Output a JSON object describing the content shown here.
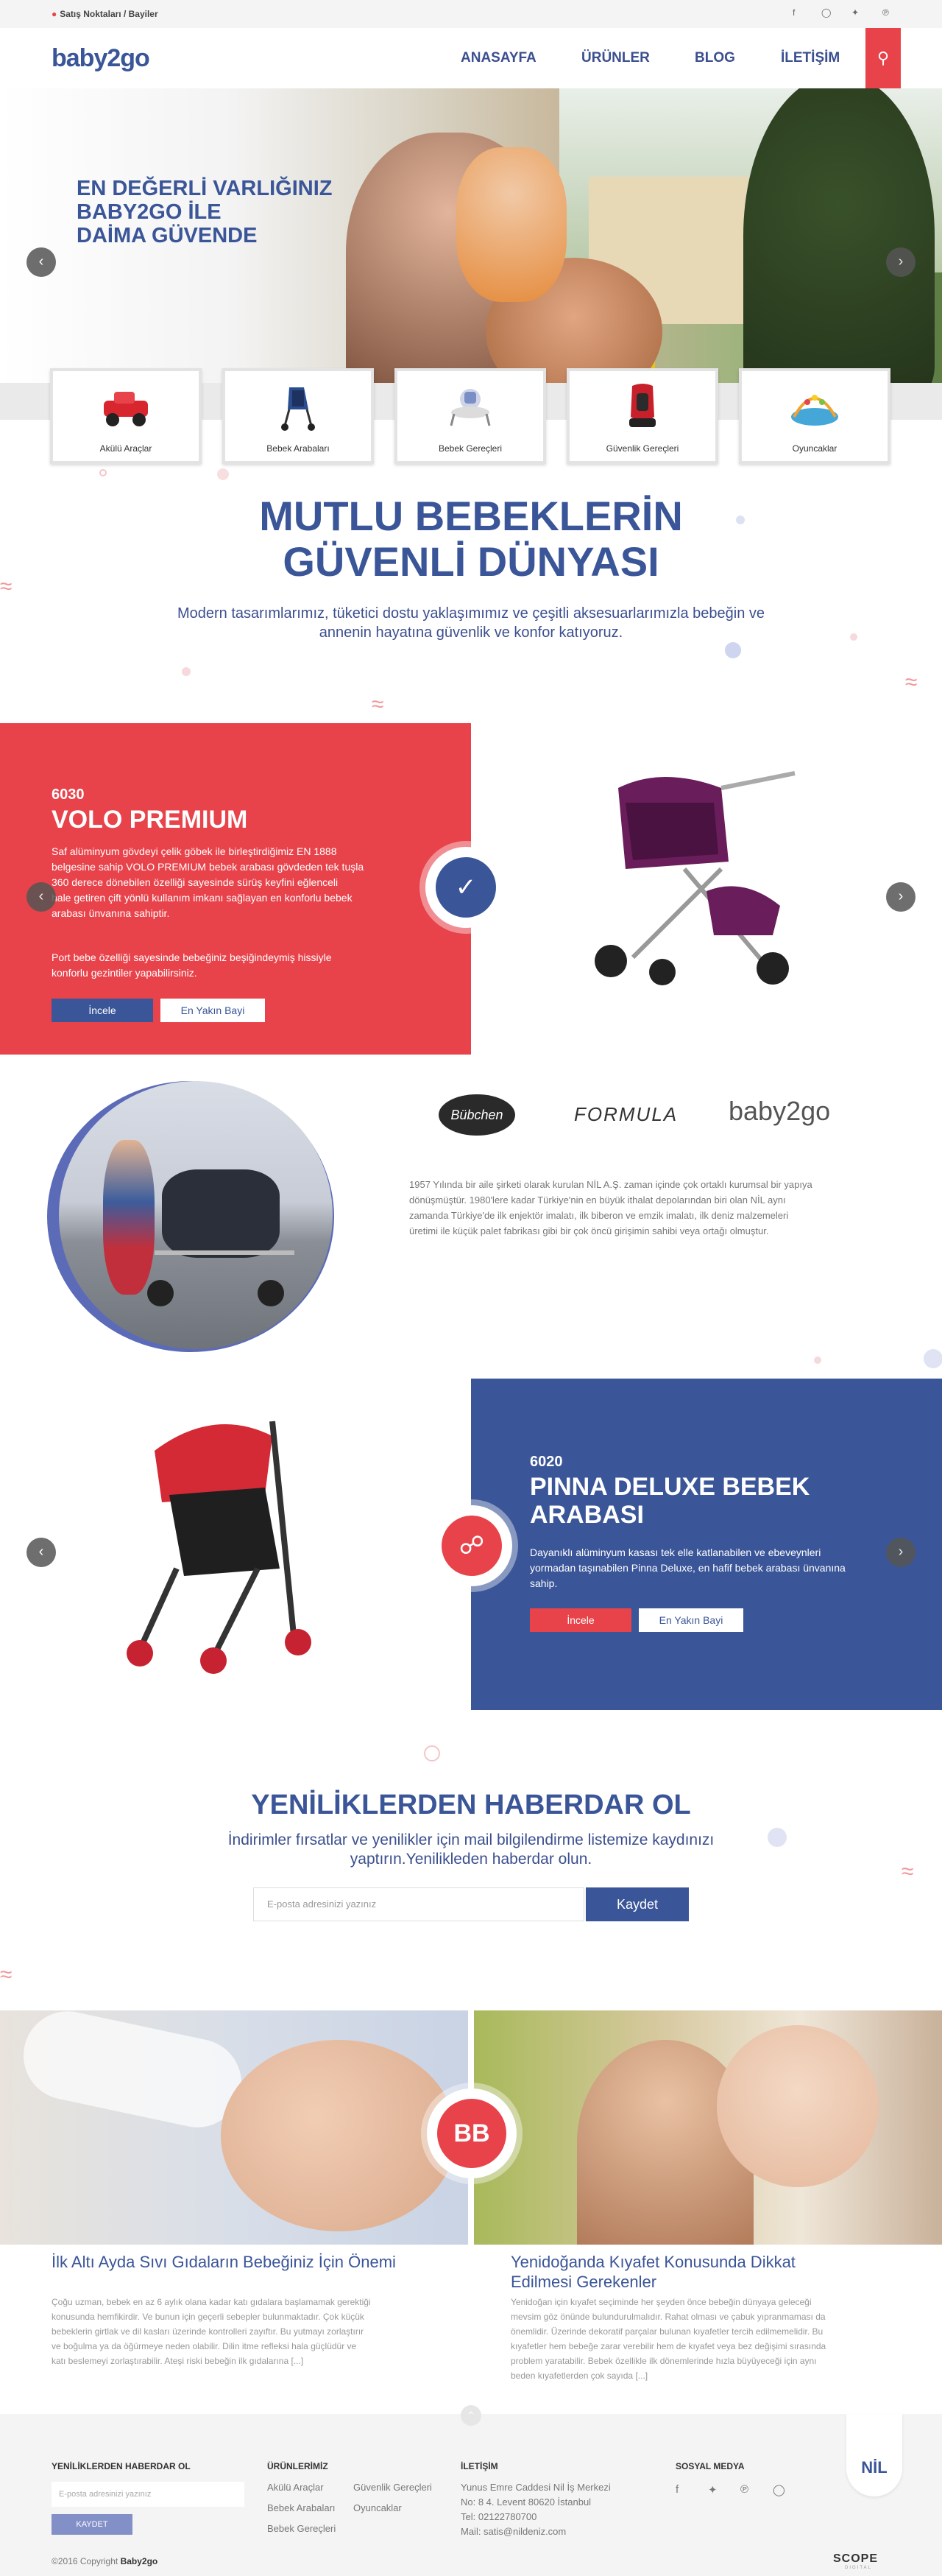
{
  "topbar": {
    "location_text": "Satış Noktaları / Bayiler",
    "social_icons": [
      "facebook-icon",
      "instagram-icon",
      "twitter-icon",
      "pinterest-icon"
    ]
  },
  "header": {
    "logo": "baby2go",
    "nav": [
      "ANASAYFA",
      "ÜRÜNLER",
      "BLOG",
      "İLETİŞİM"
    ]
  },
  "hero": {
    "headline_lines": [
      "EN DEĞERLİ VARLIĞINIZ",
      "BABY2GO İLE",
      "DAİMA GÜVENDE"
    ]
  },
  "categories": [
    {
      "label": "Akülü Araçlar",
      "icon": "ride-on-car-icon"
    },
    {
      "label": "Bebek Arabaları",
      "icon": "stroller-icon"
    },
    {
      "label": "Bebek Gereçleri",
      "icon": "walker-icon"
    },
    {
      "label": "Güvenlik Gereçleri",
      "icon": "car-seat-icon"
    },
    {
      "label": "Oyuncaklar",
      "icon": "play-gym-icon"
    }
  ],
  "intro": {
    "title_lines": [
      "MUTLU BEBEKLERİN",
      "GÜVENLİ DÜNYASI"
    ],
    "text_lines": [
      "Modern tasarımlarımız, tüketici dostu yaklaşımımız ve çeşitli aksesuarlarımızla bebeğin ve",
      "annenin hayatına güvenlik ve konfor katıyoruz."
    ]
  },
  "product1": {
    "code": "6030",
    "title": "VOLO PREMIUM",
    "desc_lines": [
      "Saf alüminyum gövdeyi çelik göbek ile birleştirdiğimiz EN 1888",
      "belgesine sahip VOLO PREMIUM bebek arabası gövdeden tek tuşla",
      "360 derece dönebilen özelliği sayesinde sürüş keyfini eğlenceli",
      "hale getiren çift yönlü kullanım imkanı sağlayan en konforlu bebek",
      "arabası ünvanına sahiptir."
    ],
    "desc2_lines": [
      "Port bebe özelliği sayesinde bebeğiniz beşiğindeymiş hissiyle",
      "konforlu gezintiler yapabilirsiniz."
    ],
    "btn_primary": "İncele",
    "btn_secondary": "En Yakın Bayi",
    "badge_icon": "shield-check-icon"
  },
  "brands": {
    "names": [
      "Bübchen",
      "FORMULA",
      "baby2go"
    ],
    "text_lines": [
      "1957 Yılında bir aile şirketi olarak kurulan NİL A.Ş. zaman içinde çok ortaklı kurumsal bir yapıya",
      "dönüşmüştür. 1980'lere kadar Türkiye'nin en büyük ithalat depolarından biri olan NİL aynı",
      "zamanda Türkiye'de ilk enjektör imalatı, ilk biberon ve emzik imalatı, ilk deniz malzemeleri",
      "üretimi ile küçük palet fabrikası gibi bir çok öncü girişimin sahibi veya ortağı olmuştur."
    ]
  },
  "product2": {
    "code": "6020",
    "title_lines": [
      "PINNA DELUXE BEBEK",
      "ARABASI"
    ],
    "desc_lines": [
      "Dayanıklı alüminyum kasası tek elle katlanabilen ve ebeveynleri",
      "yormadan taşınabilen Pinna Deluxe, en hafif bebek arabası ünvanına",
      "sahip."
    ],
    "btn_primary": "İncele",
    "btn_secondary": "En Yakın Bayi",
    "badge_icon": "stroller-icon"
  },
  "newsletter": {
    "title": "YENİLİKLERDEN HABERDAR OL",
    "text_lines": [
      "İndirimler fırsatlar ve yenilikler için mail bilgilendirme listemize kaydınızı",
      "yaptırın.Yenilikleden haberdar olun."
    ],
    "placeholder": "E-posta adresinizi yazınız",
    "button": "Kaydet"
  },
  "blog": {
    "badge": "BB",
    "posts": [
      {
        "title_lines": [
          "İlk Altı Ayda Sıvı Gıdaların Bebeğiniz İçin Önemi"
        ],
        "desc_lines": [
          "Çoğu uzman, bebek en az 6 aylık olana kadar katı gıdalara başlamamak gerektiği",
          "konusunda hemfikirdir. Ve bunun için geçerli sebepler bulunmaktadır. Çok küçük",
          "bebeklerin girtlak ve dil kasları üzerinde kontrolleri zayıftır. Bu yutmayı zorlaştırır",
          "ve boğulma ya da öğürmeye neden olabilir. Dilin itme refleksi hala güçlüdür ve",
          "katı beslemeyi zorlaştırabilir. Ateşi riski bebeğin ilk gıdalarına [...]"
        ]
      },
      {
        "title_lines": [
          "Yenidoğanda Kıyafet Konusunda Dikkat",
          "Edilmesi Gerekenler"
        ],
        "desc_lines": [
          "Yenidoğan için kıyafet seçiminde her şeyden önce bebeğin dünyaya geleceği",
          "mevsim göz önünde bulundurulmalıdır. Rahat olması ve çabuk yıpranmaması da",
          "önemlidir. Üzerinde dekoratif parçalar bulunan kıyafetler tercih edilmemelidir. Bu",
          "kıyafetler hem bebeğe zarar verebilir hem de kıyafet veya bez değişimi sırasında",
          "problem yaratabilir. Bebek özellikle ilk dönemlerinde hızla büyüyeceği için aynı",
          "beden kıyafetlerden çok sayıda [...]"
        ]
      }
    ]
  },
  "footer": {
    "newsletter_title": "YENİLİKLERDEN HABERDAR OL",
    "newsletter_placeholder": "E-posta adresinizi yazınız",
    "newsletter_button": "KAYDET",
    "products_title": "ÜRÜNLERİMİZ",
    "products_col1": [
      "Akülü Araçlar",
      "Bebek Arabaları",
      "Bebek Gereçleri"
    ],
    "products_col2": [
      "Güvenlik Gereçleri",
      "Oyuncaklar"
    ],
    "contact_title": "İLETİŞİM",
    "contact_lines": [
      "Yunus Emre Caddesi Nil İş Merkezi",
      "No: 8 4. Levent 80620 İstanbul",
      "Tel: 02122780700",
      "Mail: satis@nildeniz.com"
    ],
    "social_title": "SOSYAL MEDYA",
    "social_icons": [
      "facebook-icon",
      "twitter-icon",
      "pinterest-icon",
      "instagram-icon"
    ],
    "nil_logo": "NİL",
    "copyright_prefix": "©2016 Copyright ",
    "copyright_brand": "Baby2go",
    "scope_logo": "SCOPE",
    "scope_sub": "DIGITAL"
  },
  "colors": {
    "red": "#e8434b",
    "blue": "#3a5598",
    "footer_bg": "#f4f4f4"
  }
}
